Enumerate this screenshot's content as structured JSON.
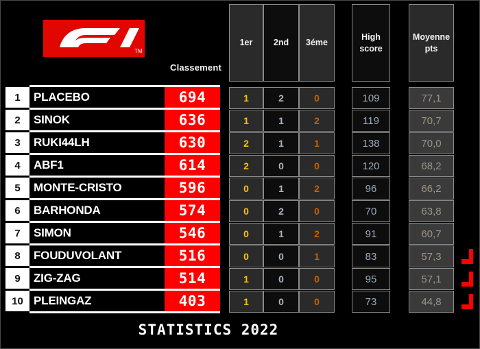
{
  "branding": {
    "logo_name": "f1-logo",
    "logo_trademark": "TM",
    "logo_color": "#e10600"
  },
  "header": {
    "classement_label": "Classement",
    "columns": [
      {
        "key": "first",
        "label": "1er",
        "color": "#f5c400"
      },
      {
        "key": "second",
        "label": "2nd",
        "color": "#a9b7c4"
      },
      {
        "key": "third",
        "label": "3éme",
        "color": "#cc6000"
      },
      {
        "key": "high",
        "label": "High\nscore"
      },
      {
        "key": "moy",
        "label": "Moyenne\npts"
      }
    ],
    "high_score_line1": "High",
    "high_score_line2": "score",
    "moyenne_line1": "Moyenne",
    "moyenne_line2": "pts"
  },
  "footer": {
    "title": "STATISTICS 2022"
  },
  "colors": {
    "accent_red": "#ff0000",
    "gold": "#f5c400",
    "silver": "#a9b7c4",
    "bronze": "#cc6000",
    "background": "#000000",
    "high_score_text": "#9bacbd",
    "average_text": "#9c9488"
  },
  "standings": [
    {
      "pos": "1",
      "name": "PLACEBO",
      "score": "694",
      "first": "1",
      "second": "2",
      "third": "0",
      "high": "109",
      "moy": "77,1",
      "relegated": false
    },
    {
      "pos": "2",
      "name": "SINOK",
      "score": "636",
      "first": "1",
      "second": "1",
      "third": "2",
      "high": "119",
      "moy": "70,7",
      "relegated": false
    },
    {
      "pos": "3",
      "name": "RUKI44LH",
      "score": "630",
      "first": "2",
      "second": "1",
      "third": "1",
      "high": "138",
      "moy": "70,0",
      "relegated": false
    },
    {
      "pos": "4",
      "name": "ABF1",
      "score": "614",
      "first": "2",
      "second": "0",
      "third": "0",
      "high": "120",
      "moy": "68,2",
      "relegated": false
    },
    {
      "pos": "5",
      "name": "MONTE-CRISTO",
      "score": "596",
      "first": "0",
      "second": "1",
      "third": "2",
      "high": "96",
      "moy": "66,2",
      "relegated": false
    },
    {
      "pos": "6",
      "name": "BARHONDA",
      "score": "574",
      "first": "0",
      "second": "2",
      "third": "0",
      "high": "70",
      "moy": "63,8",
      "relegated": false
    },
    {
      "pos": "7",
      "name": "SIMON",
      "score": "546",
      "first": "0",
      "second": "1",
      "third": "2",
      "high": "91",
      "moy": "60,7",
      "relegated": false
    },
    {
      "pos": "8",
      "name": "FOUDUVOLANT",
      "score": "516",
      "first": "0",
      "second": "0",
      "third": "1",
      "high": "83",
      "moy": "57,3",
      "relegated": true
    },
    {
      "pos": "9",
      "name": "ZIG-ZAG",
      "score": "514",
      "first": "1",
      "second": "0",
      "third": "0",
      "high": "95",
      "moy": "57,1",
      "relegated": true
    },
    {
      "pos": "10",
      "name": "PLEINGAZ",
      "score": "403",
      "first": "1",
      "second": "0",
      "third": "0",
      "high": "73",
      "moy": "44,8",
      "relegated": true
    }
  ]
}
